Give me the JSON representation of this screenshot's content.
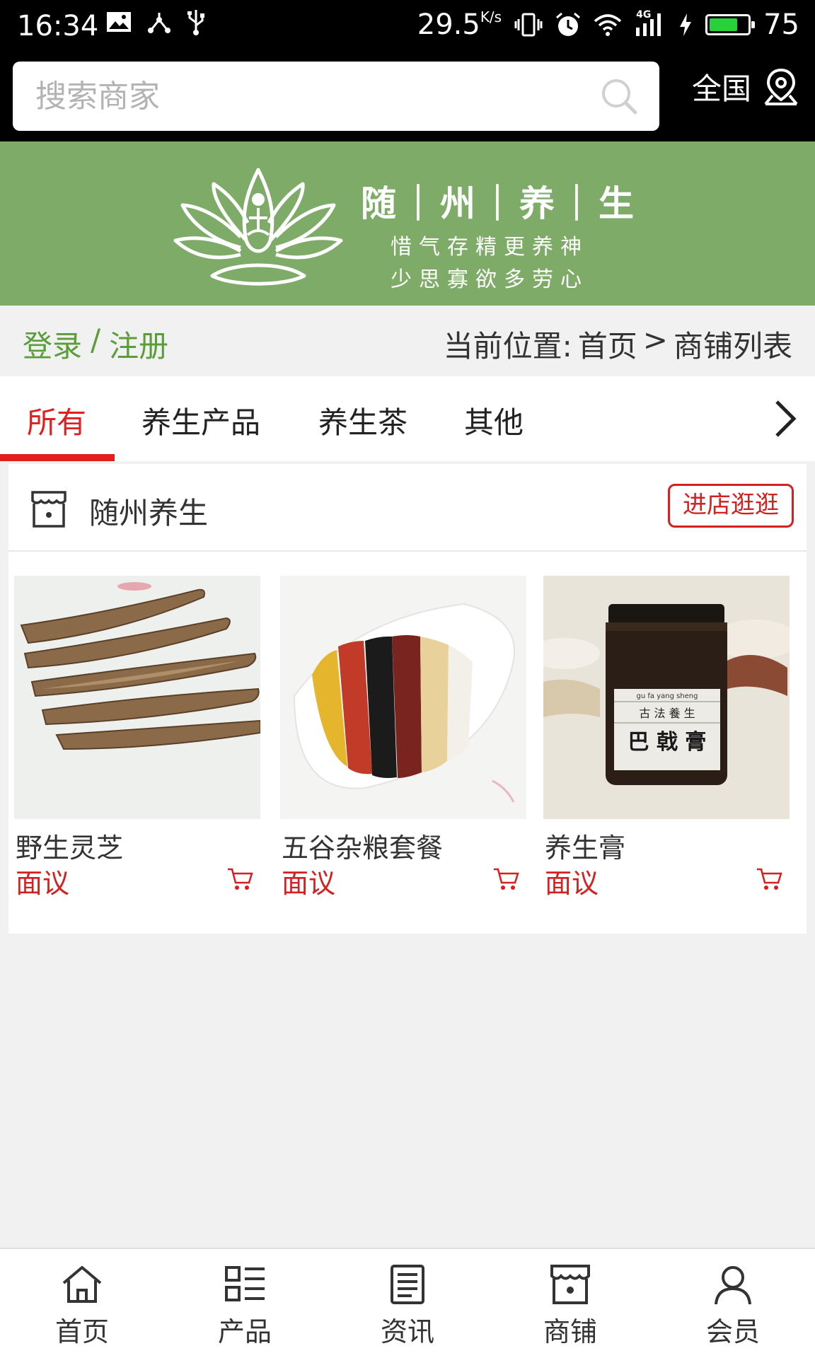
{
  "status_bar": {
    "time": "16:34",
    "net_speed": "29.5",
    "net_speed_unit": "K/s",
    "network": "4G",
    "battery": "75",
    "battery_level": 0.75,
    "battery_color": "#27d13a"
  },
  "header": {
    "search_placeholder": "搜索商家",
    "region": "全国"
  },
  "banner": {
    "brand": "随｜州｜养｜生",
    "motto_line1": "惜气存精更养神",
    "motto_line2": "少思寡欲多劳心"
  },
  "auth": {
    "login": "登录",
    "separator": "/",
    "register": "注册"
  },
  "breadcrumb": {
    "prefix": "当前位置:",
    "home": "首页",
    "arrow": ">",
    "current": "商铺列表"
  },
  "tabs": [
    {
      "label": "所有"
    },
    {
      "label": "养生产品"
    },
    {
      "label": "养生茶"
    },
    {
      "label": "其他"
    }
  ],
  "shop": {
    "name": "随州养生",
    "visit_label": "进店逛逛",
    "products": [
      {
        "name": "野生灵芝",
        "price": "面议"
      },
      {
        "name": "五谷杂粮套餐",
        "price": "面议"
      },
      {
        "name": "养生膏",
        "price": "面议",
        "jar_label_top": "gu fa yang sheng",
        "jar_label_mid": "古 法 養 生",
        "jar_label_main": "巴 戟 膏"
      }
    ]
  },
  "bottom_nav": [
    {
      "label": "首页",
      "icon": "home-icon"
    },
    {
      "label": "产品",
      "icon": "grid-list-icon"
    },
    {
      "label": "资讯",
      "icon": "news-icon"
    },
    {
      "label": "商铺",
      "icon": "store-icon"
    },
    {
      "label": "会员",
      "icon": "user-icon"
    }
  ],
  "colors": {
    "accent_red": "#e02020",
    "login_green": "#5b9d3a",
    "banner_green": "#7eab68"
  }
}
